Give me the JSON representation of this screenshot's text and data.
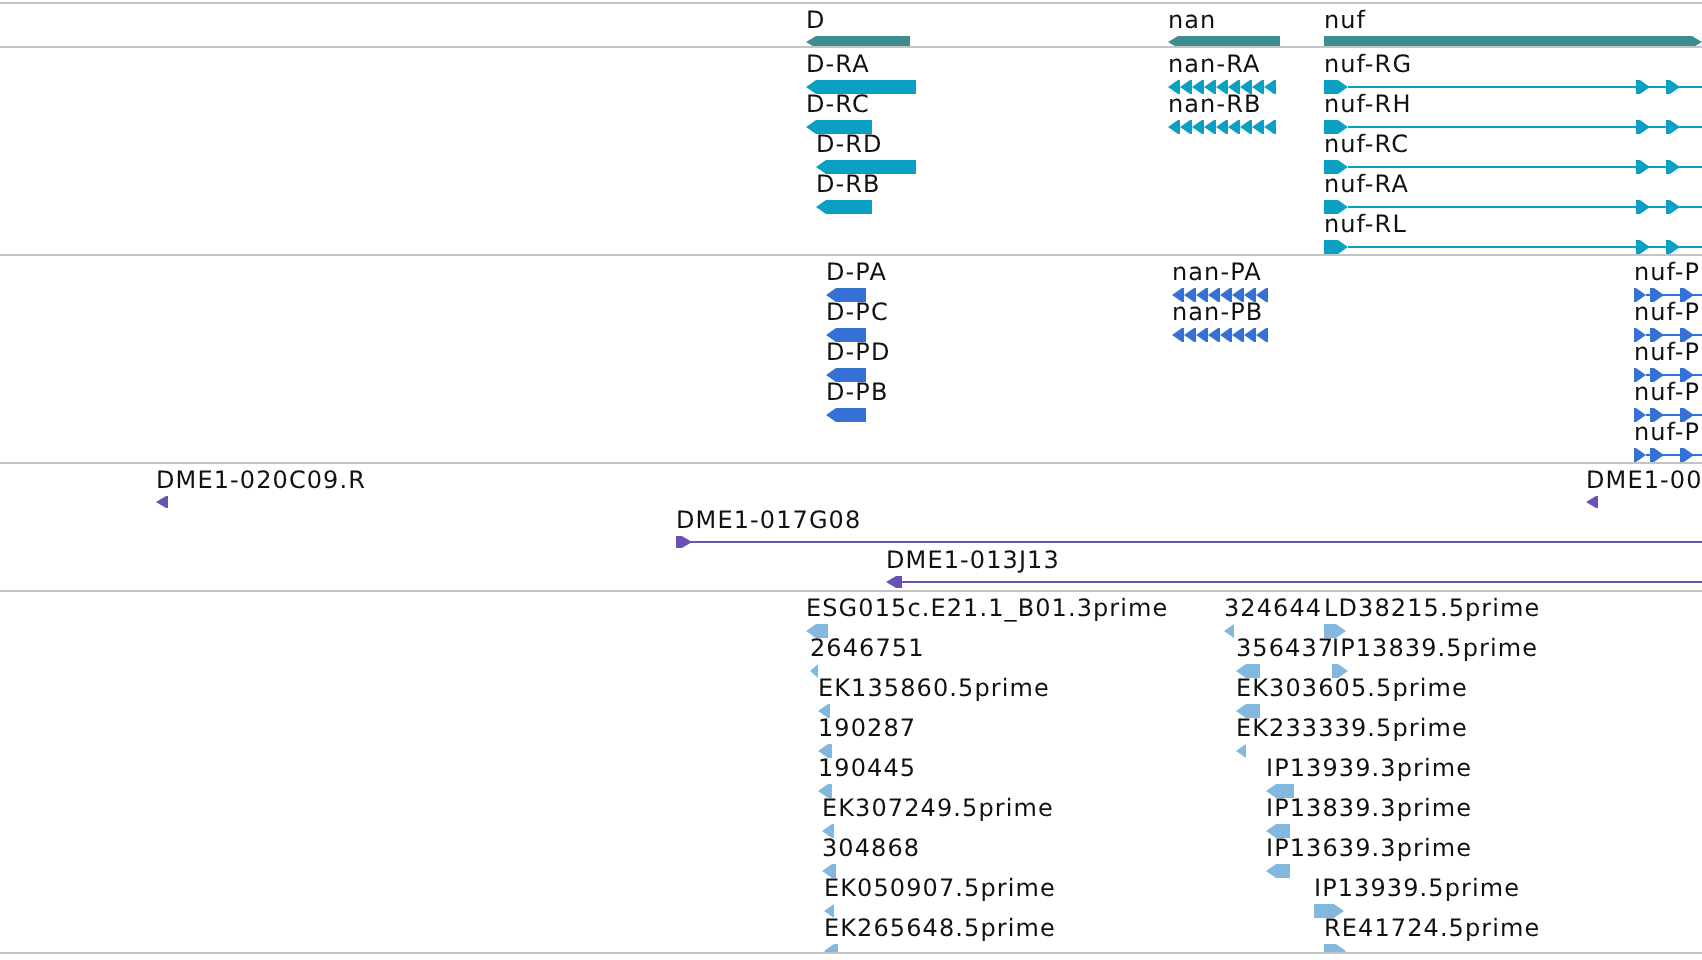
{
  "tracks": [
    {
      "kind": "gene",
      "color": "#3d8c8f",
      "features": [
        {
          "label": "D",
          "reverse": true
        },
        {
          "label": "nan",
          "reverse": true
        },
        {
          "label": "nuf",
          "reverse": false
        }
      ]
    },
    {
      "kind": "transcript",
      "color": "#0aa0c4",
      "features": [
        {
          "label": "D-RA",
          "reverse": true
        },
        {
          "label": "D-RC",
          "reverse": true
        },
        {
          "label": "D-RD",
          "reverse": true
        },
        {
          "label": "D-RB",
          "reverse": true
        },
        {
          "label": "nan-RA",
          "reverse": true
        },
        {
          "label": "nan-RB",
          "reverse": true
        },
        {
          "label": "nuf-RG",
          "reverse": false
        },
        {
          "label": "nuf-RH",
          "reverse": false
        },
        {
          "label": "nuf-RC",
          "reverse": false
        },
        {
          "label": "nuf-RA",
          "reverse": false
        },
        {
          "label": "nuf-RL",
          "reverse": false
        }
      ]
    },
    {
      "kind": "protein",
      "color": "#3570d4",
      "features": [
        {
          "label": "D-PA",
          "reverse": true
        },
        {
          "label": "D-PC",
          "reverse": true
        },
        {
          "label": "D-PD",
          "reverse": true
        },
        {
          "label": "D-PB",
          "reverse": true
        },
        {
          "label": "nan-PA",
          "reverse": true
        },
        {
          "label": "nan-PB",
          "reverse": true
        },
        {
          "label": "nuf-P",
          "reverse": false
        },
        {
          "label": "nuf-P",
          "reverse": false
        },
        {
          "label": "nuf-P",
          "reverse": false
        },
        {
          "label": "nuf-P",
          "reverse": false
        },
        {
          "label": "nuf-P",
          "reverse": false
        }
      ]
    },
    {
      "kind": "clone",
      "color": "#6a52b4",
      "features": [
        {
          "label": "DME1-020C09.R",
          "reverse": true
        },
        {
          "label": "DME1-00",
          "reverse": true
        },
        {
          "label": "DME1-017G08",
          "reverse": false
        },
        {
          "label": "DME1-013J13",
          "reverse": true
        }
      ]
    },
    {
      "kind": "est",
      "color": "#82b8de",
      "features": [
        {
          "label": "ESG015c.E21.1_B01.3prime",
          "reverse": true
        },
        {
          "label": "2646751",
          "reverse": true
        },
        {
          "label": "EK135860.5prime",
          "reverse": true
        },
        {
          "label": "190287",
          "reverse": true
        },
        {
          "label": "190445",
          "reverse": true
        },
        {
          "label": "EK307249.5prime",
          "reverse": true
        },
        {
          "label": "304868",
          "reverse": true
        },
        {
          "label": "EK050907.5prime",
          "reverse": true
        },
        {
          "label": "EK265648.5prime",
          "reverse": true
        },
        {
          "label": "324644",
          "reverse": true
        },
        {
          "label": "LD38215.5prime",
          "reverse": false
        },
        {
          "label": "356437",
          "reverse": true
        },
        {
          "label": "IP13839.5prime",
          "reverse": false
        },
        {
          "label": "EK303605.5prime",
          "reverse": true
        },
        {
          "label": "EK233339.5prime",
          "reverse": true
        },
        {
          "label": "IP13939.3prime",
          "reverse": true
        },
        {
          "label": "IP13839.3prime",
          "reverse": true
        },
        {
          "label": "IP13639.3prime",
          "reverse": true
        },
        {
          "label": "IP13939.5prime",
          "reverse": false
        },
        {
          "label": "RE41724.5prime",
          "reverse": false
        }
      ]
    }
  ]
}
